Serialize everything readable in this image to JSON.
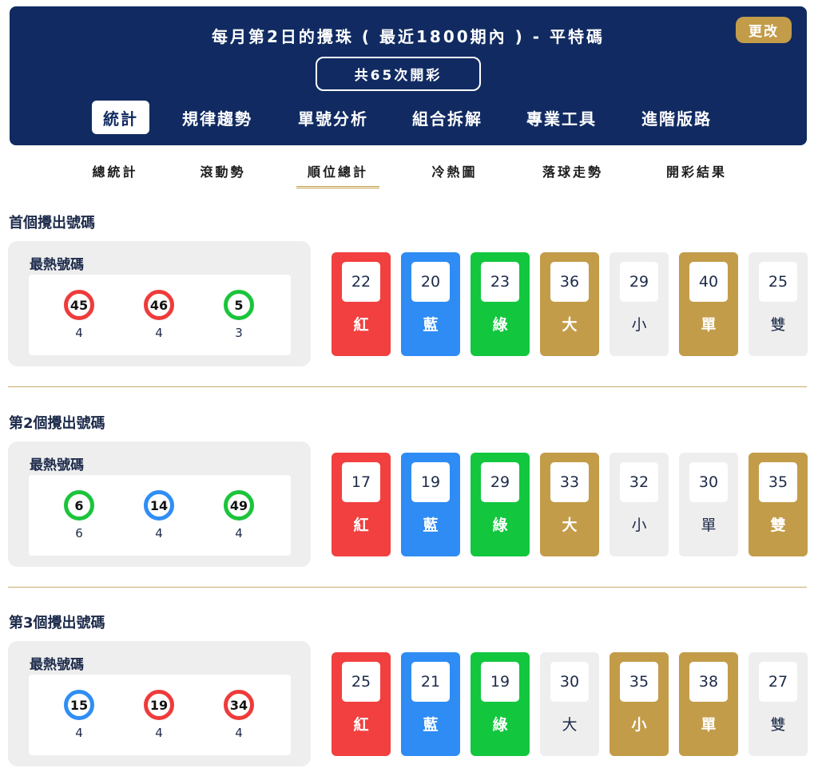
{
  "header": {
    "title": "每月第2日的攪珠 ( 最近1800期內 ) - 平特碼",
    "edit_label": "更改",
    "total_draws": "共65次開彩"
  },
  "main_tabs": [
    "統計",
    "規律趨勢",
    "單號分析",
    "組合拆解",
    "專業工具",
    "進階版路"
  ],
  "sub_tabs": [
    "總統計",
    "滾動勢",
    "順位總計",
    "冷熱圖",
    "落球走勢",
    "開彩結果"
  ],
  "hot_label": "最熱號碼",
  "sections": [
    {
      "title": "首個攪出號碼",
      "hot": [
        {
          "number": "45",
          "count": "4",
          "color": "red"
        },
        {
          "number": "46",
          "count": "4",
          "color": "red"
        },
        {
          "number": "5",
          "count": "3",
          "color": "green"
        }
      ],
      "stats": [
        {
          "value": "22",
          "label": "紅",
          "style": "red"
        },
        {
          "value": "20",
          "label": "藍",
          "style": "blue"
        },
        {
          "value": "23",
          "label": "綠",
          "style": "green"
        },
        {
          "value": "36",
          "label": "大",
          "style": "gold"
        },
        {
          "value": "29",
          "label": "小",
          "style": "gray"
        },
        {
          "value": "40",
          "label": "單",
          "style": "gold"
        },
        {
          "value": "25",
          "label": "雙",
          "style": "gray"
        }
      ]
    },
    {
      "title": "第2個攪出號碼",
      "hot": [
        {
          "number": "6",
          "count": "6",
          "color": "green"
        },
        {
          "number": "14",
          "count": "4",
          "color": "blue"
        },
        {
          "number": "49",
          "count": "4",
          "color": "green"
        }
      ],
      "stats": [
        {
          "value": "17",
          "label": "紅",
          "style": "red"
        },
        {
          "value": "19",
          "label": "藍",
          "style": "blue"
        },
        {
          "value": "29",
          "label": "綠",
          "style": "green"
        },
        {
          "value": "33",
          "label": "大",
          "style": "gold"
        },
        {
          "value": "32",
          "label": "小",
          "style": "gray"
        },
        {
          "value": "30",
          "label": "單",
          "style": "gray"
        },
        {
          "value": "35",
          "label": "雙",
          "style": "gold"
        }
      ]
    },
    {
      "title": "第3個攪出號碼",
      "hot": [
        {
          "number": "15",
          "count": "4",
          "color": "blue"
        },
        {
          "number": "19",
          "count": "4",
          "color": "red"
        },
        {
          "number": "34",
          "count": "4",
          "color": "red"
        }
      ],
      "stats": [
        {
          "value": "25",
          "label": "紅",
          "style": "red"
        },
        {
          "value": "21",
          "label": "藍",
          "style": "blue"
        },
        {
          "value": "19",
          "label": "綠",
          "style": "green"
        },
        {
          "value": "30",
          "label": "大",
          "style": "gray"
        },
        {
          "value": "35",
          "label": "小",
          "style": "gold"
        },
        {
          "value": "38",
          "label": "單",
          "style": "gold"
        },
        {
          "value": "27",
          "label": "雙",
          "style": "gray"
        }
      ]
    }
  ]
}
